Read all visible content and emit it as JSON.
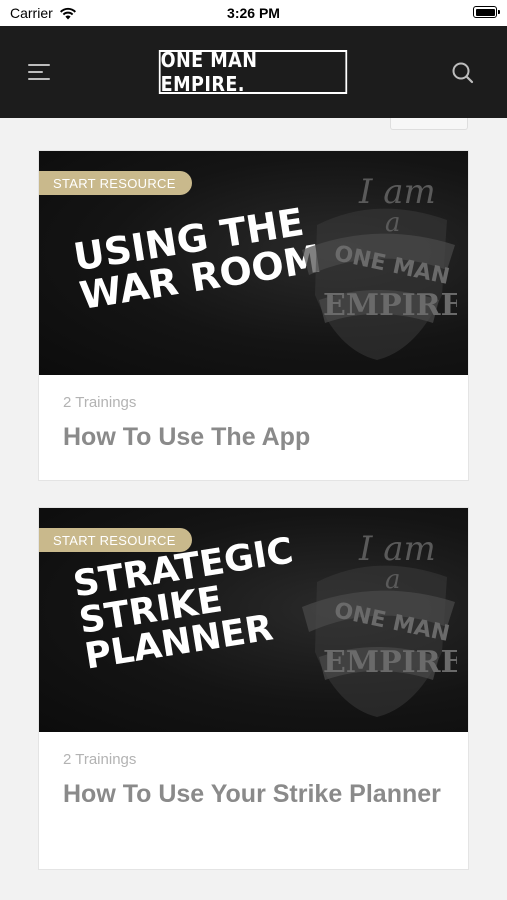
{
  "status_bar": {
    "carrier": "Carrier",
    "time": "3:26 PM"
  },
  "header": {
    "logo_text": "ONE MAN EMPIRE."
  },
  "cards": [
    {
      "badge": "START RESOURCE",
      "thumbnail_title_lines": [
        "USING THE",
        "WAR ROOM"
      ],
      "meta": "2 Trainings",
      "title": "How To Use The App"
    },
    {
      "badge": "START RESOURCE",
      "thumbnail_title_lines": [
        "STRATEGIC",
        "STRIKE",
        "PLANNER"
      ],
      "meta": "2 Trainings",
      "title": "How To Use Your Strike Planner"
    }
  ],
  "emblem_text": {
    "line1": "I am",
    "line2": "a",
    "line3": "ONE MAN",
    "line4": "EMPIRE"
  },
  "colors": {
    "header_bg": "#1c1c1c",
    "badge": "#c9b98c",
    "page_bg": "#f2f2f2"
  },
  "icons": [
    "wifi-icon",
    "battery-icon",
    "menu-icon",
    "search-icon"
  ]
}
